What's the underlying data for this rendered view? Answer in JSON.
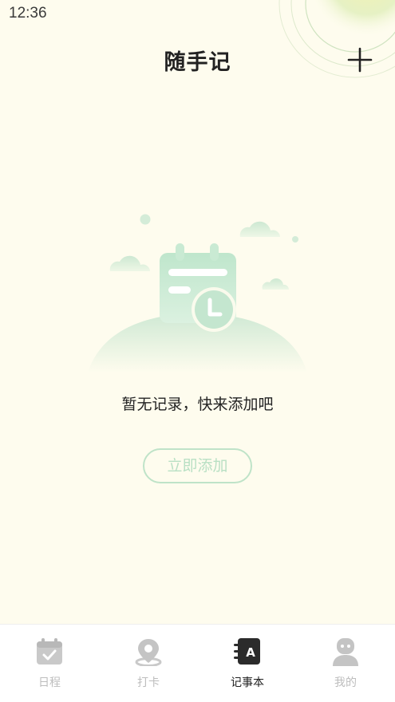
{
  "status_bar": {
    "time": "12:36"
  },
  "header": {
    "title": "随手记",
    "add_icon": "plus-icon"
  },
  "empty_state": {
    "illustration": "calendar-clock-illustration",
    "message": "暂无记录，快来添加吧",
    "add_now_label": "立即添加"
  },
  "tab_bar": {
    "active_index": 2,
    "items": [
      {
        "label": "日程",
        "icon": "calendar-check-icon"
      },
      {
        "label": "打卡",
        "icon": "location-pin-icon"
      },
      {
        "label": "记事本",
        "icon": "notebook-icon"
      },
      {
        "label": "我的",
        "icon": "user-icon"
      }
    ]
  },
  "colors": {
    "background": "#fefcee",
    "accent_green": "#bfe3c8",
    "tab_inactive": "#bdbdbd",
    "tab_active": "#222222"
  }
}
